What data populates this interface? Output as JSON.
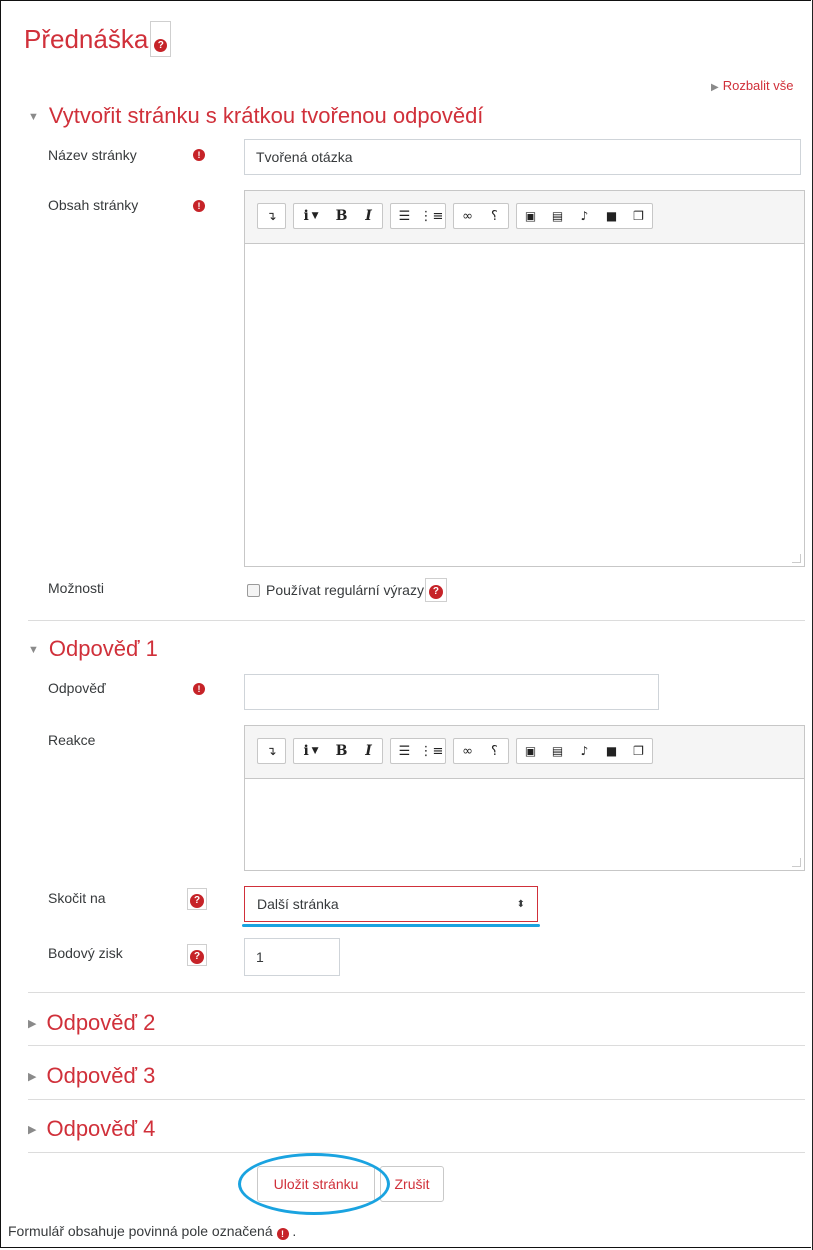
{
  "page": {
    "title": "Přednáška",
    "expand_all": "Rozbalit vše",
    "footer_note": "Formulář obsahuje povinná pole označená",
    "footer_period": "."
  },
  "colors": {
    "accent": "#d0303a",
    "highlight": "#1aa3e0",
    "border": "#cfd4d9"
  },
  "section_main": {
    "heading": "Vytvořit stránku s krátkou tvořenou odpovědí",
    "page_name_label": "Název stránky",
    "page_name_value": "Tvořená otázka",
    "page_content_label": "Obsah stránky",
    "options_label": "Možnosti",
    "regex_checkbox_label": "Používat regulární výrazy"
  },
  "section_answer1": {
    "heading": "Odpověď 1",
    "answer_label": "Odpověď",
    "answer_value": "",
    "feedback_label": "Reakce",
    "jump_label": "Skočit na",
    "jump_value": "Další stránka",
    "score_label": "Bodový zisk",
    "score_value": "1"
  },
  "collapsed_sections": [
    "Odpověď 2",
    "Odpověď 3",
    "Odpověď 4"
  ],
  "buttons": {
    "save": "Uložit stránku",
    "cancel": "Zrušit"
  },
  "toolbar_icons": [
    "collapse-icon",
    "italic-style-icon",
    "bold-icon",
    "italic-icon",
    "unordered-list-icon",
    "ordered-list-icon",
    "link-icon",
    "unlink-icon",
    "image-icon",
    "media-icon",
    "record-audio-icon",
    "record-video-icon",
    "manage-files-icon"
  ]
}
